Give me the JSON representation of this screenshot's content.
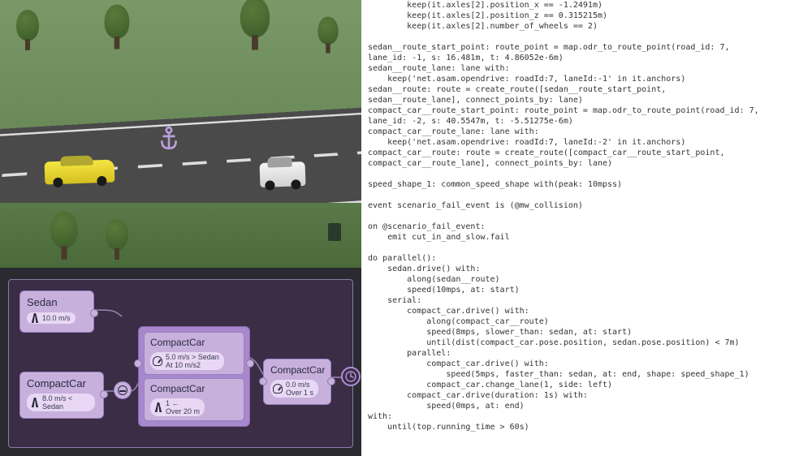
{
  "code_lines": [
    "        keep(it.axles[2].position_x == -1.2491m)",
    "        keep(it.axles[2].position_z == 0.315215m)",
    "        keep(it.axles[2].number_of_wheels == 2)",
    "",
    "sedan__route_start_point: route_point = map.odr_to_route_point(road_id: 7,",
    "lane_id: -1, s: 16.481m, t: 4.86052e-6m)",
    "sedan__route_lane: lane with:",
    "    keep('net.asam.opendrive: roadId:7, laneId:-1' in it.anchors)",
    "sedan__route: route = create_route([sedan__route_start_point,",
    "sedan__route_lane], connect_points_by: lane)",
    "compact_car__route_start_point: route_point = map.odr_to_route_point(road_id: 7,",
    "lane_id: -2, s: 40.5547m, t: -5.51275e-6m)",
    "compact_car__route_lane: lane with:",
    "    keep('net.asam.opendrive: roadId:7, laneId:-2' in it.anchors)",
    "compact_car__route: route = create_route([compact_car__route_start_point,",
    "compact_car__route_lane], connect_points_by: lane)",
    "",
    "speed_shape_1: common_speed_shape with(peak: 10mpss)",
    "",
    "event scenario_fail_event is (@mw_collision)",
    "",
    "on @scenario_fail_event:",
    "    emit cut_in_and_slow.fail",
    "",
    "do parallel():",
    "    sedan.drive() with:",
    "        along(sedan__route)",
    "        speed(10mps, at: start)",
    "    serial:",
    "        compact_car.drive() with:",
    "            along(compact_car__route)",
    "            speed(8mps, slower_than: sedan, at: start)",
    "            until(dist(compact_car.pose.position, sedan.pose.position) < 7m)",
    "        parallel:",
    "            compact_car.drive() with:",
    "                speed(5mps, faster_than: sedan, at: end, shape: speed_shape_1)",
    "            compact_car.change_lane(1, side: left)",
    "        compact_car.drive(duration: 1s) with:",
    "            speed(0mps, at: end)",
    "with:",
    "    until(top.running_time > 60s)"
  ],
  "graph": {
    "sedan": {
      "title": "Sedan",
      "speed": "10.0 m/s"
    },
    "cc_left": {
      "title": "CompactCar",
      "speed": "8.0 m/s < Sedan"
    },
    "cc_mid_top": {
      "title": "CompactCar",
      "l1": "5.0 m/s > Sedan",
      "l2": "At 10 m/s2"
    },
    "cc_mid_bot": {
      "title": "CompactCar",
      "l1": "1 ←",
      "l2": "Over 20 m"
    },
    "cc_right": {
      "title": "CompactCar",
      "l1": "0.0 m/s",
      "l2": "Over 1 s"
    }
  },
  "sim": {
    "car1": "sedan-yellow",
    "car2": "compact-white",
    "anchor": "anchor-marker"
  }
}
